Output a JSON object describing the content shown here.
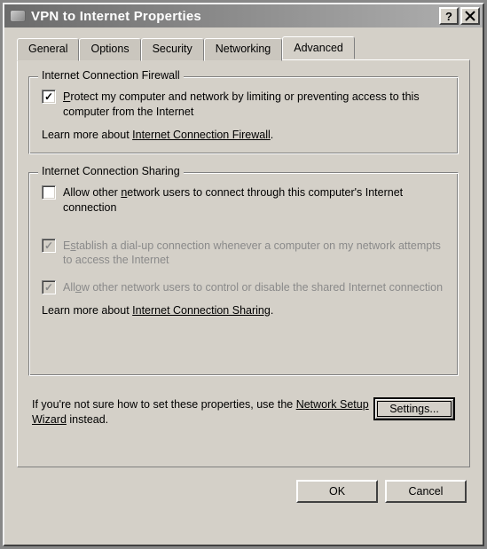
{
  "window": {
    "title": "VPN to Internet Properties"
  },
  "tabs": {
    "general": "General",
    "options": "Options",
    "security": "Security",
    "networking": "Networking",
    "advanced": "Advanced"
  },
  "firewall": {
    "legend": "Internet Connection Firewall",
    "protect_checked": "✓",
    "protect_label_pre": "P",
    "protect_label": "rotect my computer and network by limiting or preventing access to this computer from the Internet",
    "learn_pre": "Learn more about ",
    "learn_link": "Internet Connection Firewall",
    "learn_post": "."
  },
  "sharing": {
    "legend": "Internet Connection Sharing",
    "allow_connect_label_pre": "Allow other ",
    "allow_connect_u": "n",
    "allow_connect_label_post": "etwork users to connect through this computer's Internet connection",
    "dialup_checked": "✓",
    "dialup_label_pre": "E",
    "dialup_u": "s",
    "dialup_label_post": "tablish a dial-up connection whenever a computer on my network attempts to access the Internet",
    "control_checked": "✓",
    "control_label_pre": "All",
    "control_u": "o",
    "control_label_post": "w other network users to control or disable the shared Internet connection",
    "learn_pre": "Learn more about ",
    "learn_link": "Internet Connection Sharing",
    "learn_post": "."
  },
  "hint": {
    "pre": "If you're not sure how to set these properties, use the ",
    "link": "Network Setup Wizard",
    "post": " instead."
  },
  "buttons": {
    "settings": "Settings...",
    "ok": "OK",
    "cancel": "Cancel"
  }
}
